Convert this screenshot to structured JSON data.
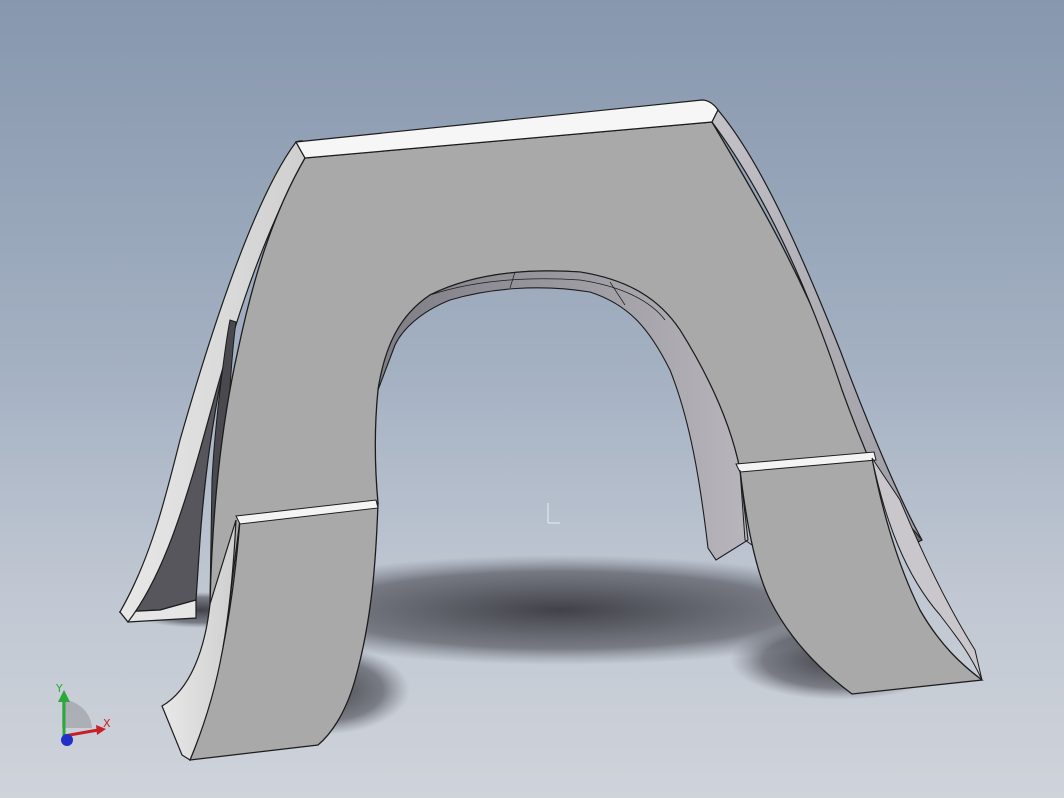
{
  "viewport": {
    "background_top": "#8797ad",
    "background_bottom": "#cfd3da"
  },
  "model": {
    "face_color": "#a8a8a8",
    "edge_color": "#1c1c1c",
    "highlight_color": "#f4f4f4",
    "shadow_color": "#3c3c42"
  },
  "triad": {
    "x_label": "X",
    "y_label": "Y",
    "x_color": "#c8202a",
    "y_color": "#2aa838",
    "z_color": "#2230c8"
  },
  "icons": {
    "view_triad": "axis-triad-icon",
    "origin": "origin-marker-icon"
  }
}
